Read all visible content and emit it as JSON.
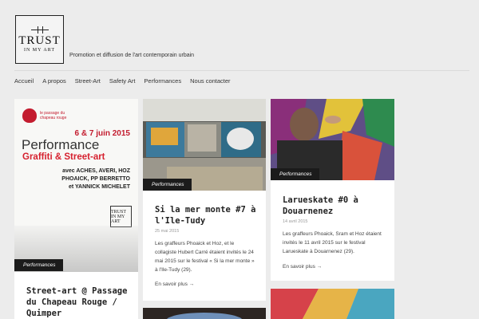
{
  "logo": {
    "big_text": "TRUST",
    "small_text": "IN MY ART"
  },
  "tagline": "Promotion et diffusion de l'art contemporain urbain",
  "nav": [
    "Accueil",
    "A propos",
    "Street-Art",
    "Safety Art",
    "Performances",
    "Nous contacter"
  ],
  "cards": [
    {
      "badge": "Performances",
      "title": "Street-art @ Passage du Chapeau Rouge / Quimper",
      "poster": {
        "venue": "le passage du chapeau rouge",
        "dates": "6 & 7 juin 2015",
        "headline": "Performance",
        "subhead": "Graffiti & Street-art",
        "artists": [
          "avec ACHES, AVERI, HOZ",
          "PHOAICK, PP BERRETTO",
          "et YANNICK MICHELET"
        ],
        "logo_text": "TRUST IN MY ART"
      }
    },
    {
      "badge": "Performances",
      "title": "Si la mer monte #7 à l'Ile-Tudy",
      "date": "25 mai 2015",
      "excerpt": "Les graffeurs Phoaick et Hoz, et le collagiste Hubert Carré étaient invités le 24 mai 2015 sur le festival « Si la mer monte » à l'Ile-Tudy (29).",
      "more": "En savoir plus →"
    },
    {
      "badge": "Performances",
      "title": "Larueskate #0 à Douarnenez",
      "date": "14 avril 2015",
      "excerpt": "Les graffeurs Phoaick, Sram et Hoz étaient invités le 11 avril 2015 sur le festival Larueskate à Douarnenez (29).",
      "more": "En savoir plus →"
    }
  ],
  "colors": {
    "accent_red": "#c31c2f",
    "badge_bg": "#1b1b1b",
    "page_bg": "#ececec"
  }
}
